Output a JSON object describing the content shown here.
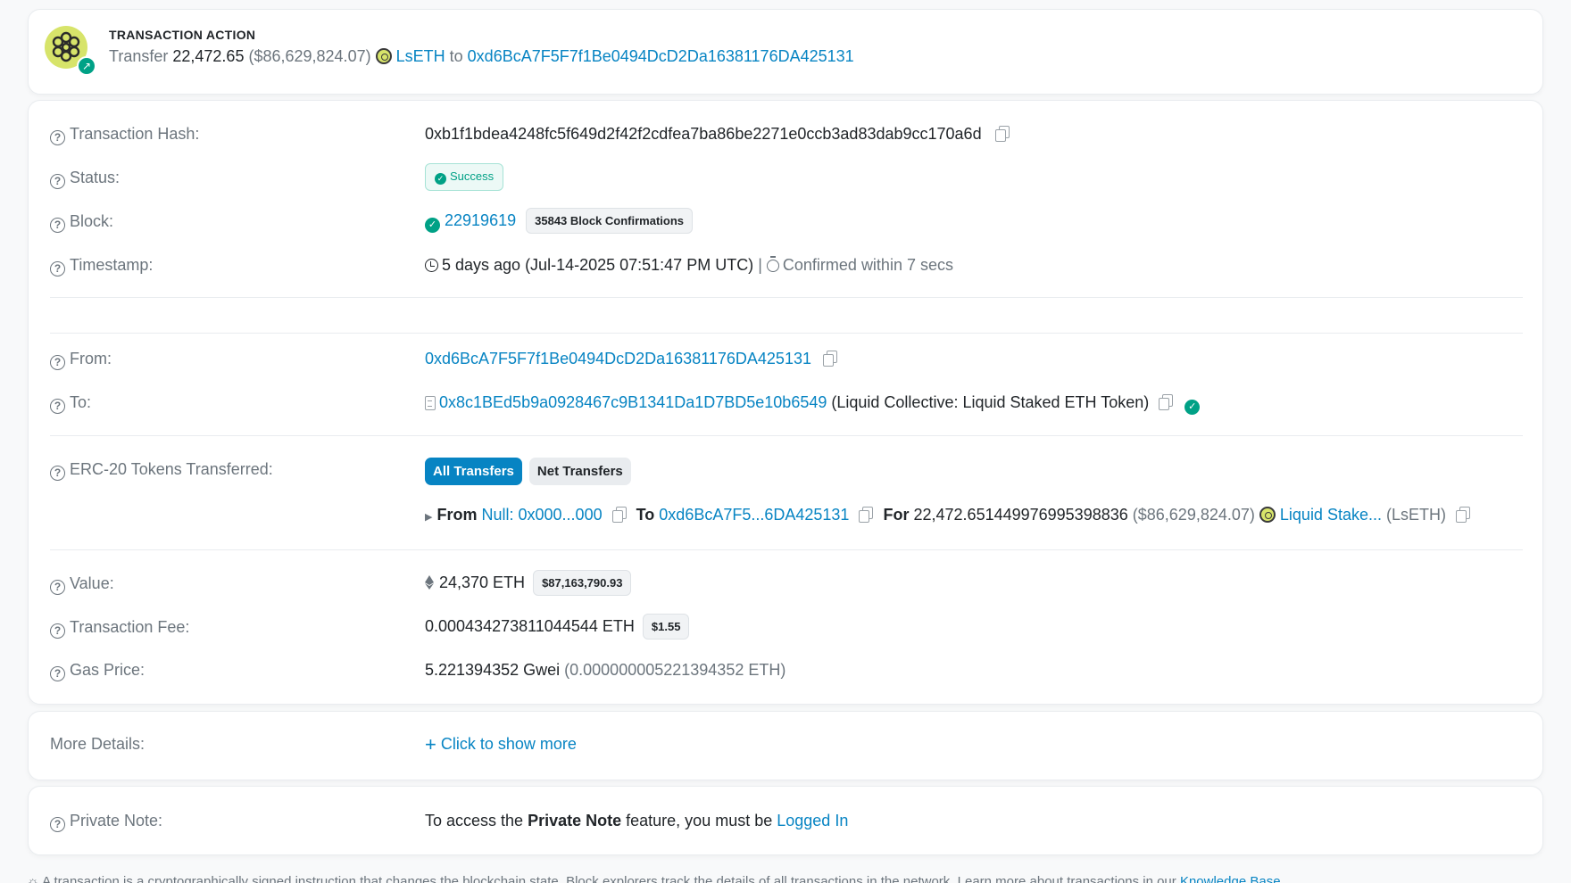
{
  "action": {
    "title": "TRANSACTION ACTION",
    "verb": "Transfer",
    "amount": "22,472.65",
    "amount_usd": "($86,629,824.07)",
    "token_symbol": "LsETH",
    "to_word": "to",
    "to_address": "0xd6BcA7F5F7f1Be0494DcD2Da16381176DA425131"
  },
  "overview": {
    "tx_hash_label": "Transaction Hash:",
    "tx_hash": "0xb1f1bdea4248fc5f649d2f42f2cdfea7ba86be2271e0ccb3ad83dab9cc170a6d",
    "status_label": "Status:",
    "status": "Success",
    "block_label": "Block:",
    "block_number": "22919619",
    "block_confirmations": "35843 Block Confirmations",
    "timestamp_label": "Timestamp:",
    "timestamp": "5 days ago (Jul-14-2025 07:51:47 PM UTC)",
    "timestamp_sep": "|",
    "confirmed": "Confirmed within 7 secs",
    "from_label": "From:",
    "from_address": "0xd6BcA7F5F7f1Be0494DcD2Da16381176DA425131",
    "to_label": "To:",
    "to_address": "0x8c1BEd5b9a0928467c9B1341Da1D7BD5e10b6549",
    "to_name": "(Liquid Collective: Liquid Staked ETH Token)",
    "erc20_label": "ERC-20 Tokens Transferred:",
    "tabs": [
      "All Transfers",
      "Net Transfers"
    ],
    "transfer": {
      "from_word": "From",
      "from_value": "Null: 0x000...000",
      "to_word": "To",
      "to_value": "0xd6BcA7F5...6DA425131",
      "for_word": "For",
      "amount": "22,472.651449976995398836",
      "amount_usd": "($86,629,824.07)",
      "token_name": "Liquid Stake...",
      "token_symbol": "(LsETH)"
    },
    "value_label": "Value:",
    "value": "24,370 ETH",
    "value_usd": "$87,163,790.93",
    "fee_label": "Transaction Fee:",
    "fee": "0.000434273811044544 ETH",
    "fee_usd": "$1.55",
    "gas_label": "Gas Price:",
    "gas_gwei": "5.221394352 Gwei",
    "gas_eth": "(0.000000005221394352 ETH)"
  },
  "more": {
    "label": "More Details:",
    "link": "Click to show more"
  },
  "note": {
    "label": "Private Note:",
    "text_before": "To access the",
    "text_bold": "Private Note",
    "text_mid": "feature, you must be",
    "link": "Logged In"
  },
  "footer": {
    "text": "A transaction is a cryptographically signed instruction that changes the blockchain state. Block explorers track the details of all transactions in the network. Learn more about transactions in our",
    "link": "Knowledge Base"
  },
  "colors": {
    "link": "#0784c3",
    "success": "#00a186",
    "muted": "#6c757d"
  }
}
